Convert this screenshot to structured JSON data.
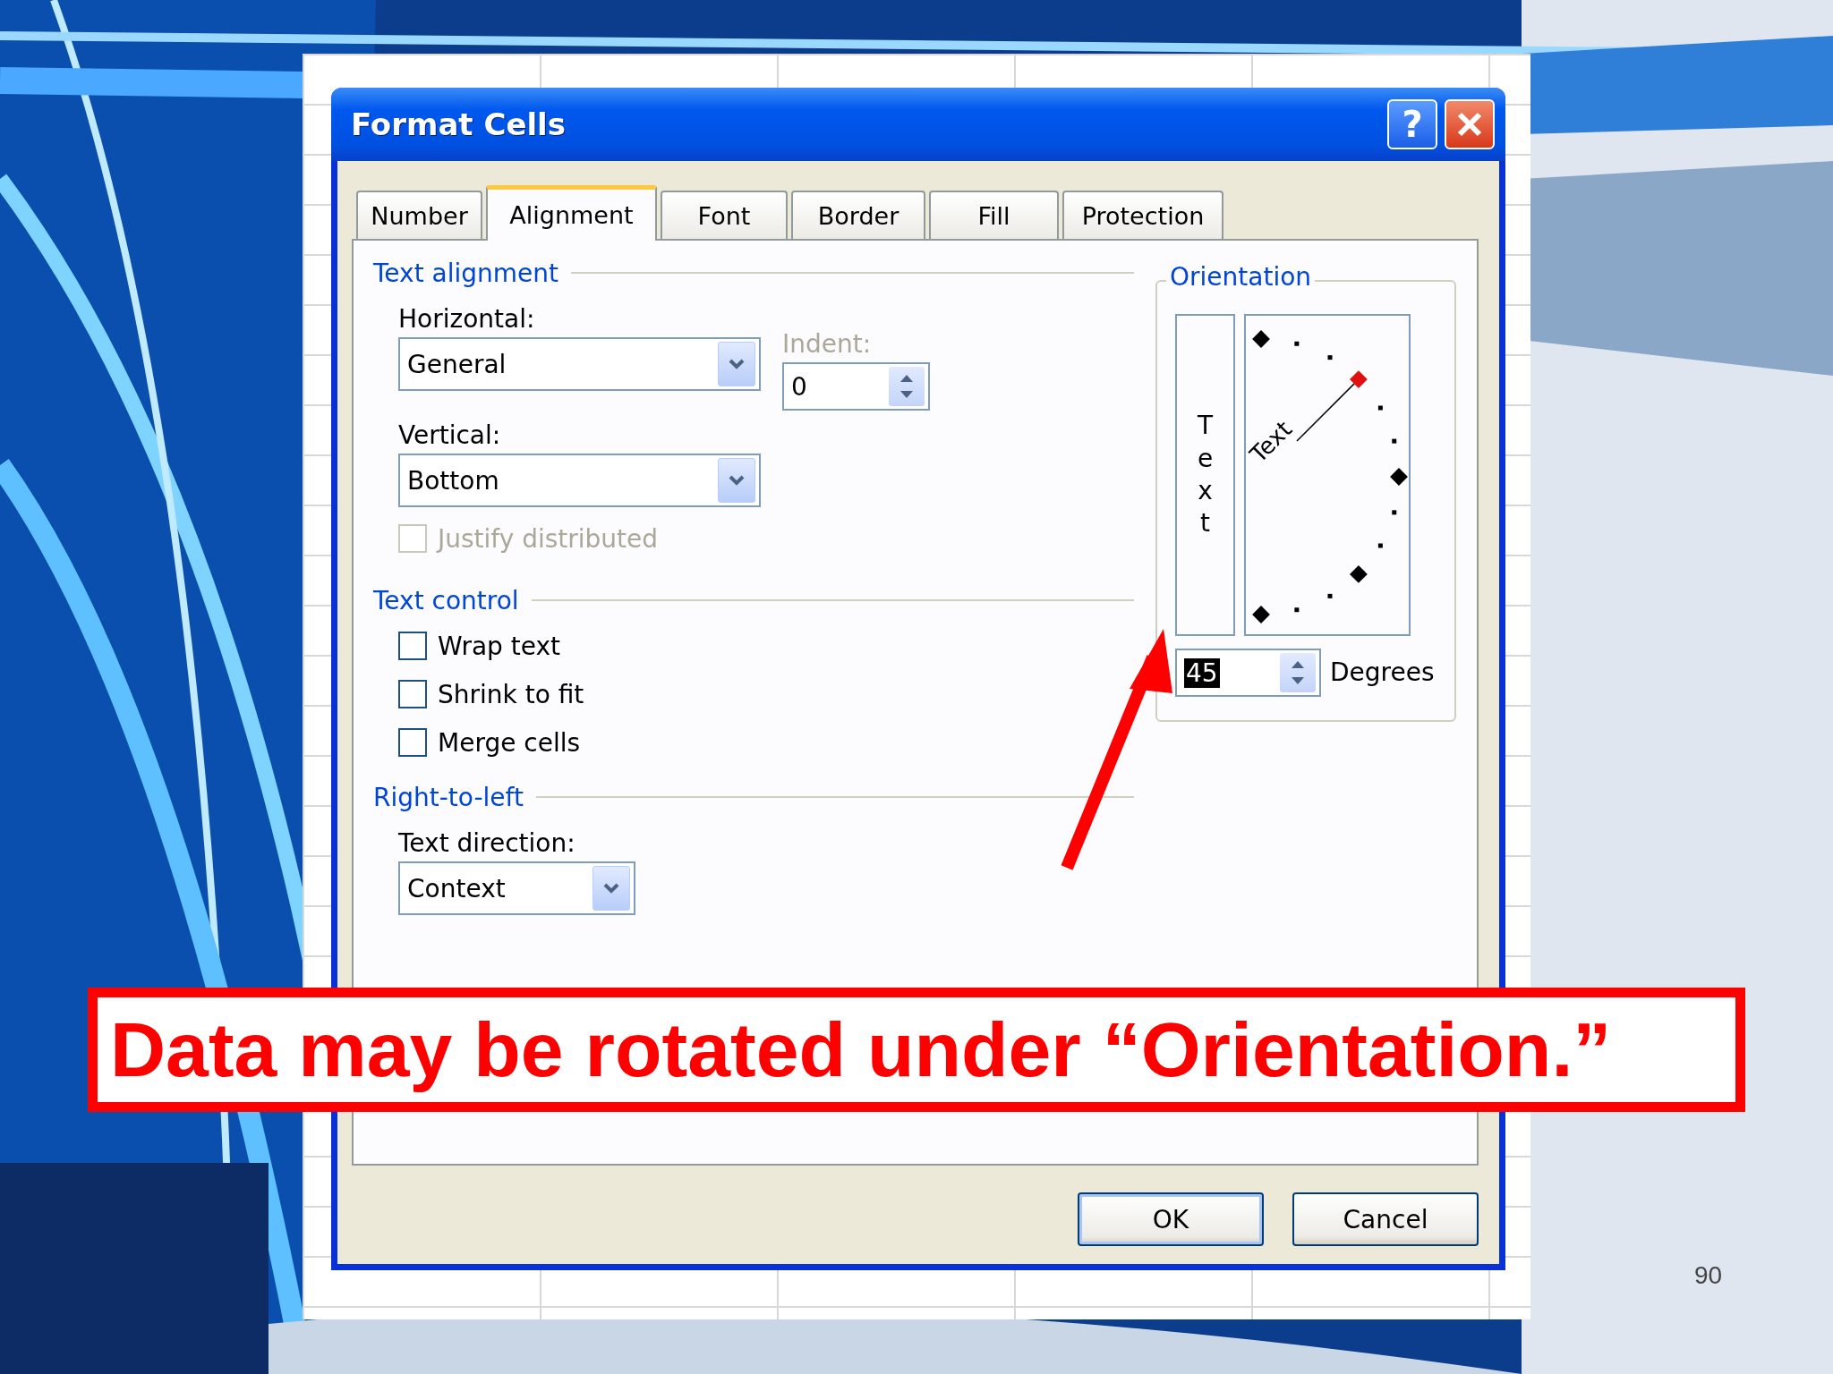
{
  "window": {
    "title": "Format Cells",
    "help_button": "?"
  },
  "tabs": [
    {
      "label": "Number",
      "selected": false
    },
    {
      "label": "Alignment",
      "selected": true
    },
    {
      "label": "Font",
      "selected": false
    },
    {
      "label": "Border",
      "selected": false
    },
    {
      "label": "Fill",
      "selected": false
    },
    {
      "label": "Protection",
      "selected": false
    }
  ],
  "text_alignment": {
    "heading": "Text alignment",
    "horizontal_label": "Horizontal:",
    "horizontal_value": "General",
    "indent_label": "Indent:",
    "indent_value": "0",
    "vertical_label": "Vertical:",
    "vertical_value": "Bottom",
    "justify_distributed": {
      "label": "Justify distributed",
      "checked": false,
      "disabled": true
    }
  },
  "text_control": {
    "heading": "Text control",
    "options": [
      {
        "label": "Wrap text",
        "checked": false,
        "disabled": false
      },
      {
        "label": "Shrink to fit",
        "checked": false,
        "disabled": false
      },
      {
        "label": "Merge cells",
        "checked": false,
        "disabled": false
      }
    ]
  },
  "right_to_left": {
    "heading": "Right-to-left",
    "direction_label": "Text direction:",
    "direction_value": "Context"
  },
  "orientation": {
    "heading": "Orientation",
    "vertical_text": "Text",
    "dial_text": "Text",
    "degrees_value": "45",
    "degrees_value_selected": true,
    "degrees_label": "Degrees"
  },
  "buttons": [
    "OK",
    "Cancel"
  ],
  "callout": "Data may be rotated under “Orientation.”",
  "page_number": "90"
}
